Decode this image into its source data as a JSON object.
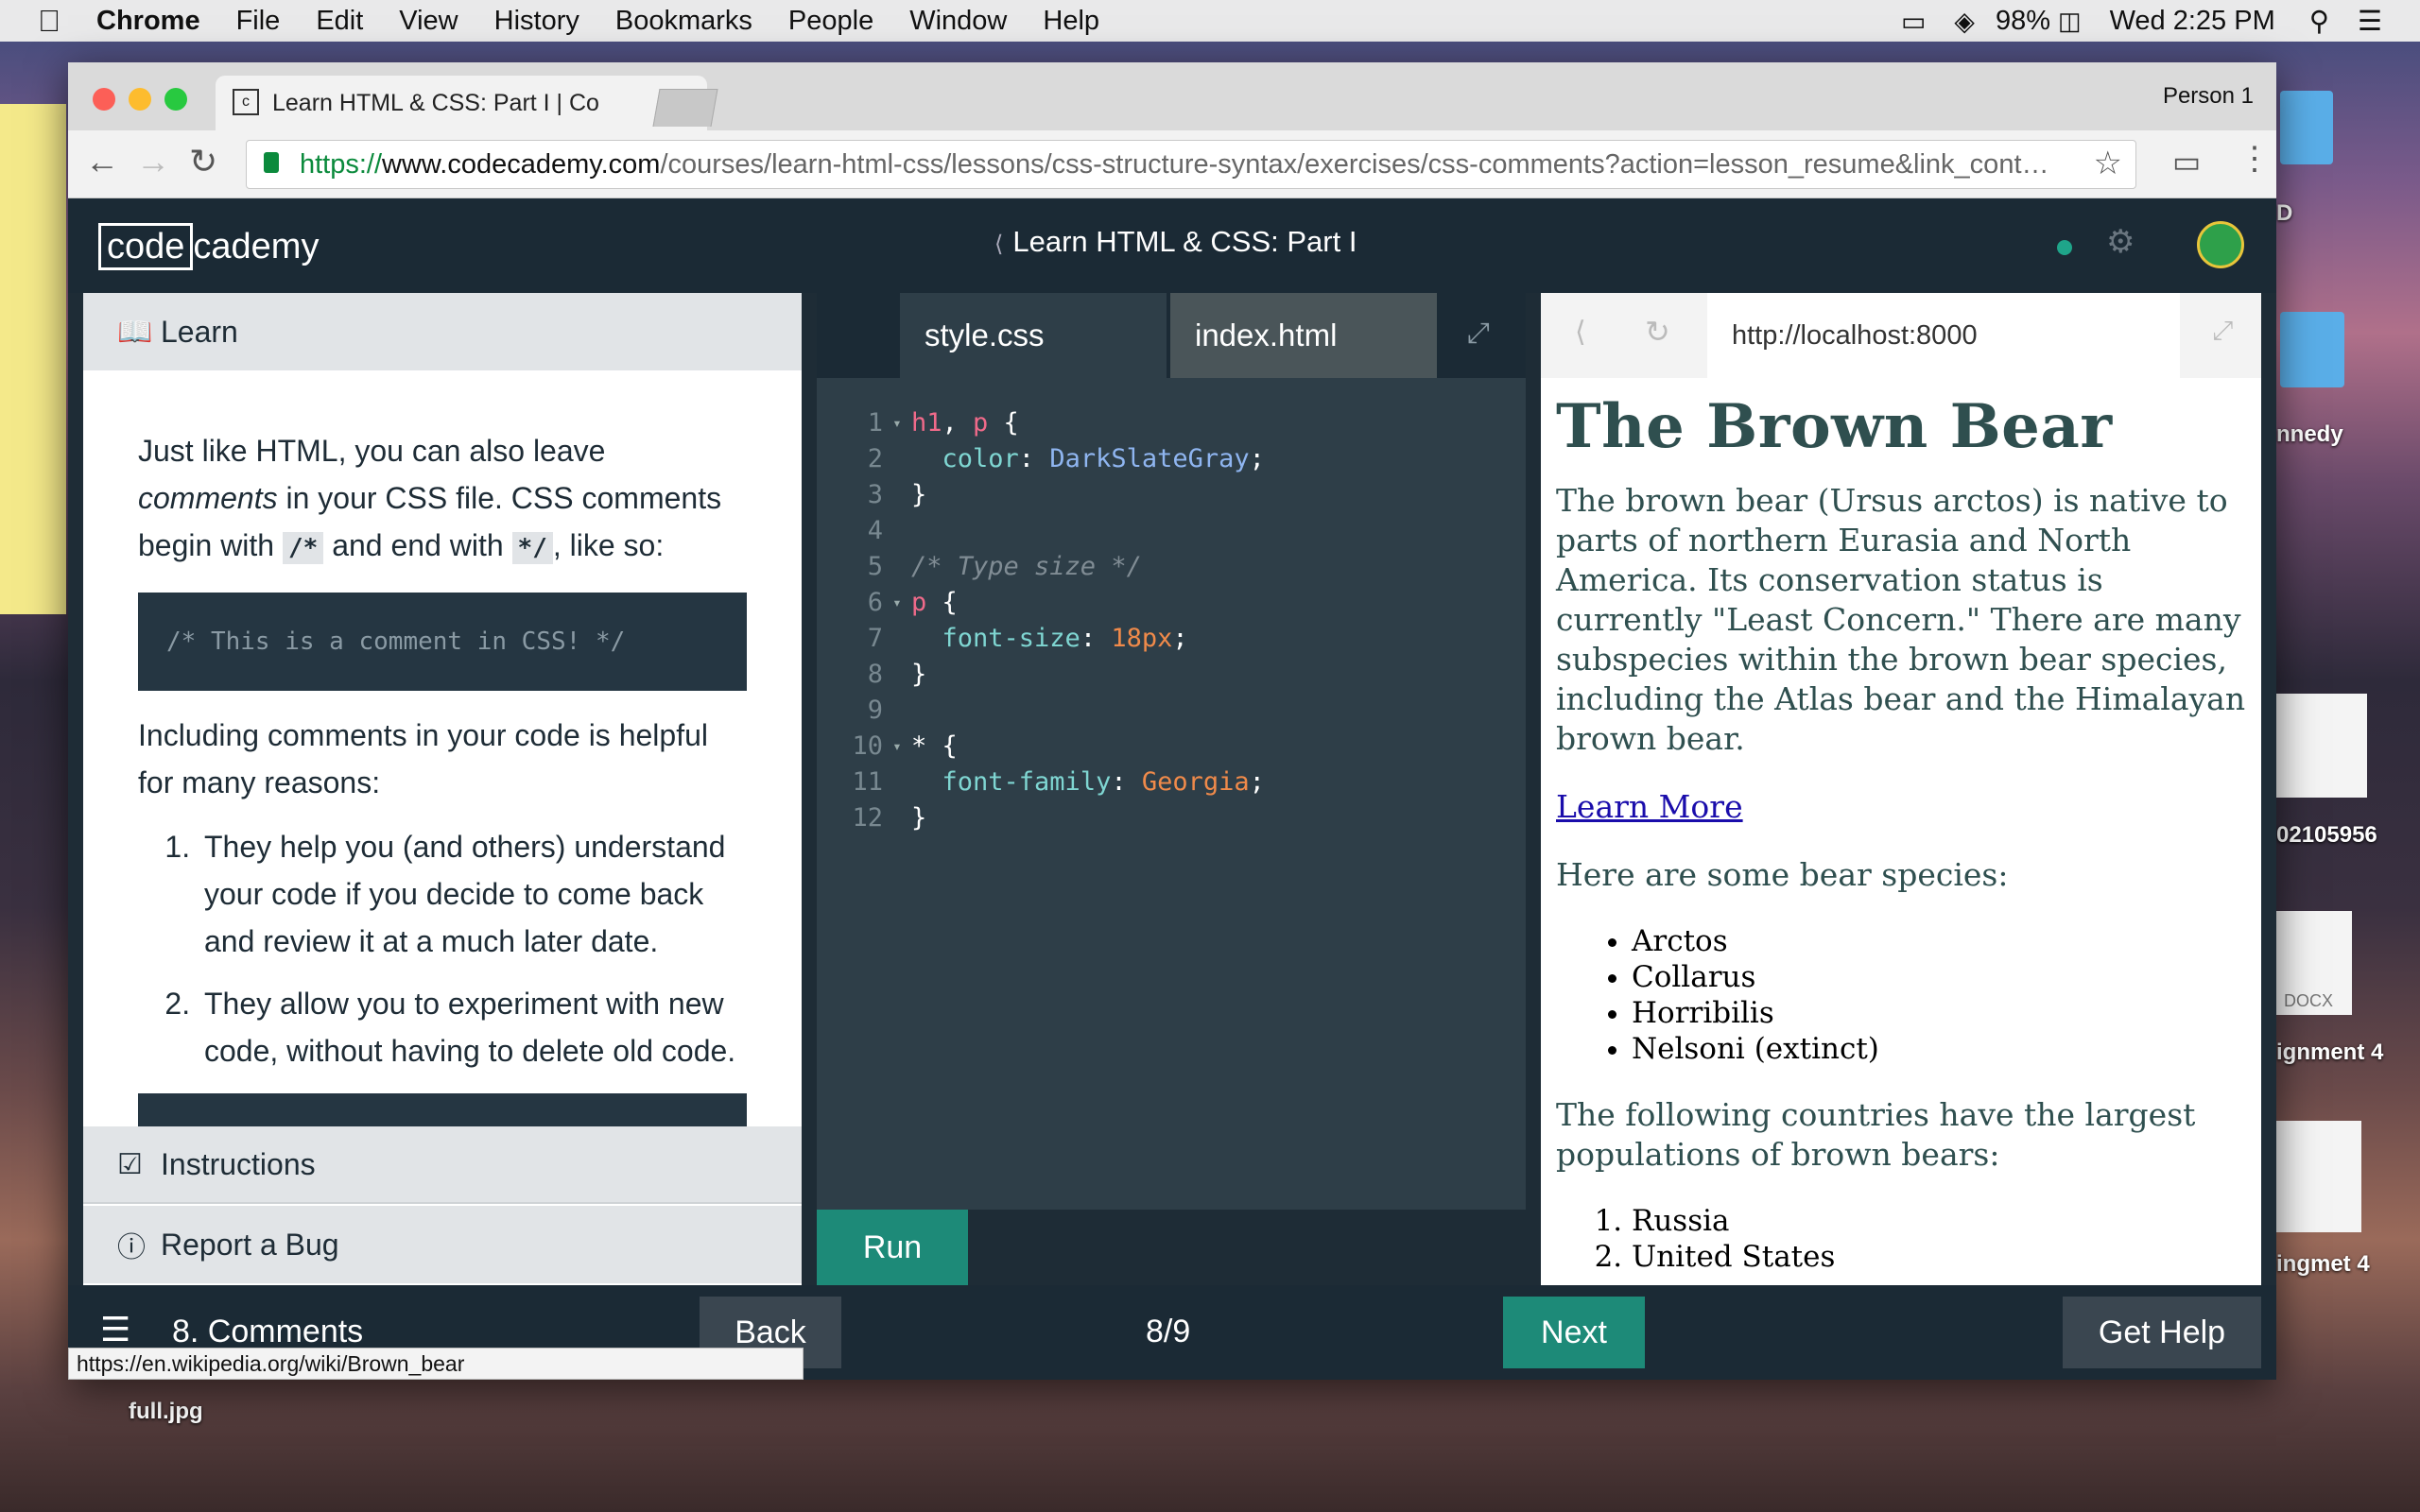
{
  "menubar": {
    "items": [
      "Chrome",
      "File",
      "Edit",
      "View",
      "History",
      "Bookmarks",
      "People",
      "Window",
      "Help"
    ],
    "battery": "98%",
    "clock": "Wed 2:25 PM"
  },
  "desktop": {
    "labels": [
      "full.jpg",
      "nnedy",
      "02105956",
      "ignment 4",
      "ingmet 4",
      "D",
      "DOCX"
    ]
  },
  "browser": {
    "tab_title": "Learn HTML & CSS: Part I | Co",
    "profile": "Person 1",
    "url_scheme": "https://",
    "url_host": "www.codecademy.com",
    "url_path": "/courses/learn-html-css/lessons/css-structure-syntax/exercises/css-comments?action=lesson_resume&link_cont…",
    "status_tooltip": "https://en.wikipedia.org/wiki/Brown_bear"
  },
  "app": {
    "logo_left": "code",
    "logo_right": "cademy",
    "course_title": "Learn HTML & CSS: Part I",
    "accent": "#1d8a78"
  },
  "left_panel": {
    "learn_label": "Learn",
    "intro_1": "Just like HTML, you can also leave ",
    "intro_em": "comments",
    "intro_2": " in your CSS file. CSS comments begin with ",
    "code_open": "/*",
    "intro_3": " and end with ",
    "code_close": "*/",
    "intro_4": ", like so:",
    "example": "/* This is a comment in CSS! */",
    "para2": "Including comments in your code is helpful for many reasons:",
    "reasons": [
      "They help you (and others) understand your code if you decide to come back and review it at a much later date.",
      "They allow you to experiment with new code, without having to delete old code."
    ],
    "instructions_label": "Instructions",
    "bug_label": "Report a Bug"
  },
  "editor": {
    "tabs": [
      "style.css",
      "index.html"
    ],
    "lines": [
      {
        "n": "1",
        "fold": "▾",
        "parts": [
          [
            "sel",
            "h1"
          ],
          [
            "cd",
            ", "
          ],
          [
            "sel",
            "p"
          ],
          [
            "cd",
            " {"
          ]
        ]
      },
      {
        "n": "2",
        "fold": "",
        "parts": [
          [
            "cd",
            "  "
          ],
          [
            "prop",
            "color"
          ],
          [
            "cd",
            ": "
          ],
          [
            "val",
            "DarkSlateGray"
          ],
          [
            "cd",
            ";"
          ]
        ]
      },
      {
        "n": "3",
        "fold": "",
        "parts": [
          [
            "cd",
            "}"
          ]
        ]
      },
      {
        "n": "4",
        "fold": "",
        "parts": []
      },
      {
        "n": "5",
        "fold": "",
        "parts": [
          [
            "cmt",
            "/* Type size */"
          ]
        ]
      },
      {
        "n": "6",
        "fold": "▾",
        "parts": [
          [
            "sel",
            "p"
          ],
          [
            "cd",
            " {"
          ]
        ]
      },
      {
        "n": "7",
        "fold": "",
        "parts": [
          [
            "cd",
            "  "
          ],
          [
            "prop",
            "font-size"
          ],
          [
            "cd",
            ": "
          ],
          [
            "num2",
            "18px"
          ],
          [
            "cd",
            ";"
          ]
        ]
      },
      {
        "n": "8",
        "fold": "",
        "parts": [
          [
            "cd",
            "}"
          ]
        ]
      },
      {
        "n": "9",
        "fold": "",
        "parts": []
      },
      {
        "n": "10",
        "fold": "▾",
        "parts": [
          [
            "cd",
            "* {"
          ]
        ]
      },
      {
        "n": "11",
        "fold": "",
        "parts": [
          [
            "cd",
            "  "
          ],
          [
            "prop",
            "font-family"
          ],
          [
            "cd",
            ": "
          ],
          [
            "num2",
            "Georgia"
          ],
          [
            "cd",
            ";"
          ]
        ]
      },
      {
        "n": "12",
        "fold": "",
        "parts": [
          [
            "cd",
            "}"
          ]
        ]
      }
    ],
    "run_label": "Run"
  },
  "preview": {
    "url": "http://localhost:8000",
    "heading": "The Brown Bear",
    "para1": "The brown bear (Ursus arctos) is native to parts of northern Eurasia and North America. Its conservation status is currently \"Least Concern.\" There are many subspecies within the brown bear species, including the Atlas bear and the Himalayan brown bear.",
    "link": "Learn More",
    "species_intro": "Here are some bear species:",
    "species": [
      "Arctos",
      "Collarus",
      "Horribilis",
      "Nelsoni (extinct)"
    ],
    "countries_intro": "The following countries have the largest populations of brown bears:",
    "countries": [
      "Russia",
      "United States"
    ]
  },
  "bottom": {
    "lesson_label": "8. Comments",
    "back": "Back",
    "progress": "8/9",
    "next": "Next",
    "help": "Get Help"
  }
}
